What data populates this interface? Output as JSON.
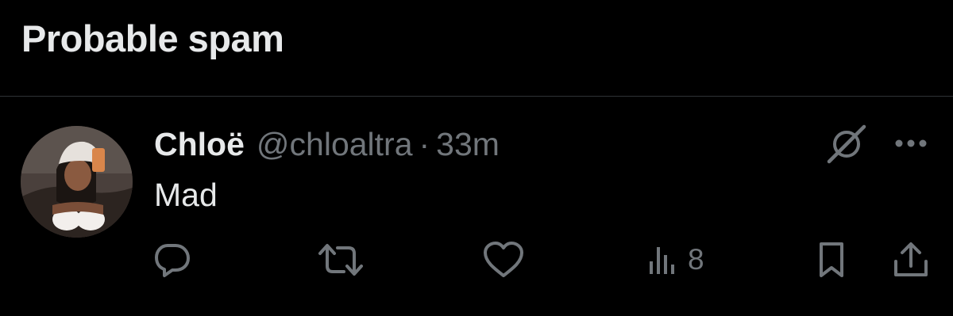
{
  "section": {
    "title": "Probable spam"
  },
  "tweet": {
    "display_name": "Chloë",
    "handle": "@chloaltra",
    "separator": "·",
    "timestamp": "33m",
    "text": "Mad",
    "views_count": "8"
  },
  "icons": {
    "top_right": [
      "grok-icon",
      "more-icon"
    ],
    "actions": [
      "reply-icon",
      "retweet-icon",
      "like-icon",
      "views-icon",
      "bookmark-icon",
      "share-icon"
    ]
  },
  "colors": {
    "background": "#000000",
    "primary_text": "#e7e9ea",
    "secondary_text": "#71767b",
    "divider": "#2f3336"
  }
}
